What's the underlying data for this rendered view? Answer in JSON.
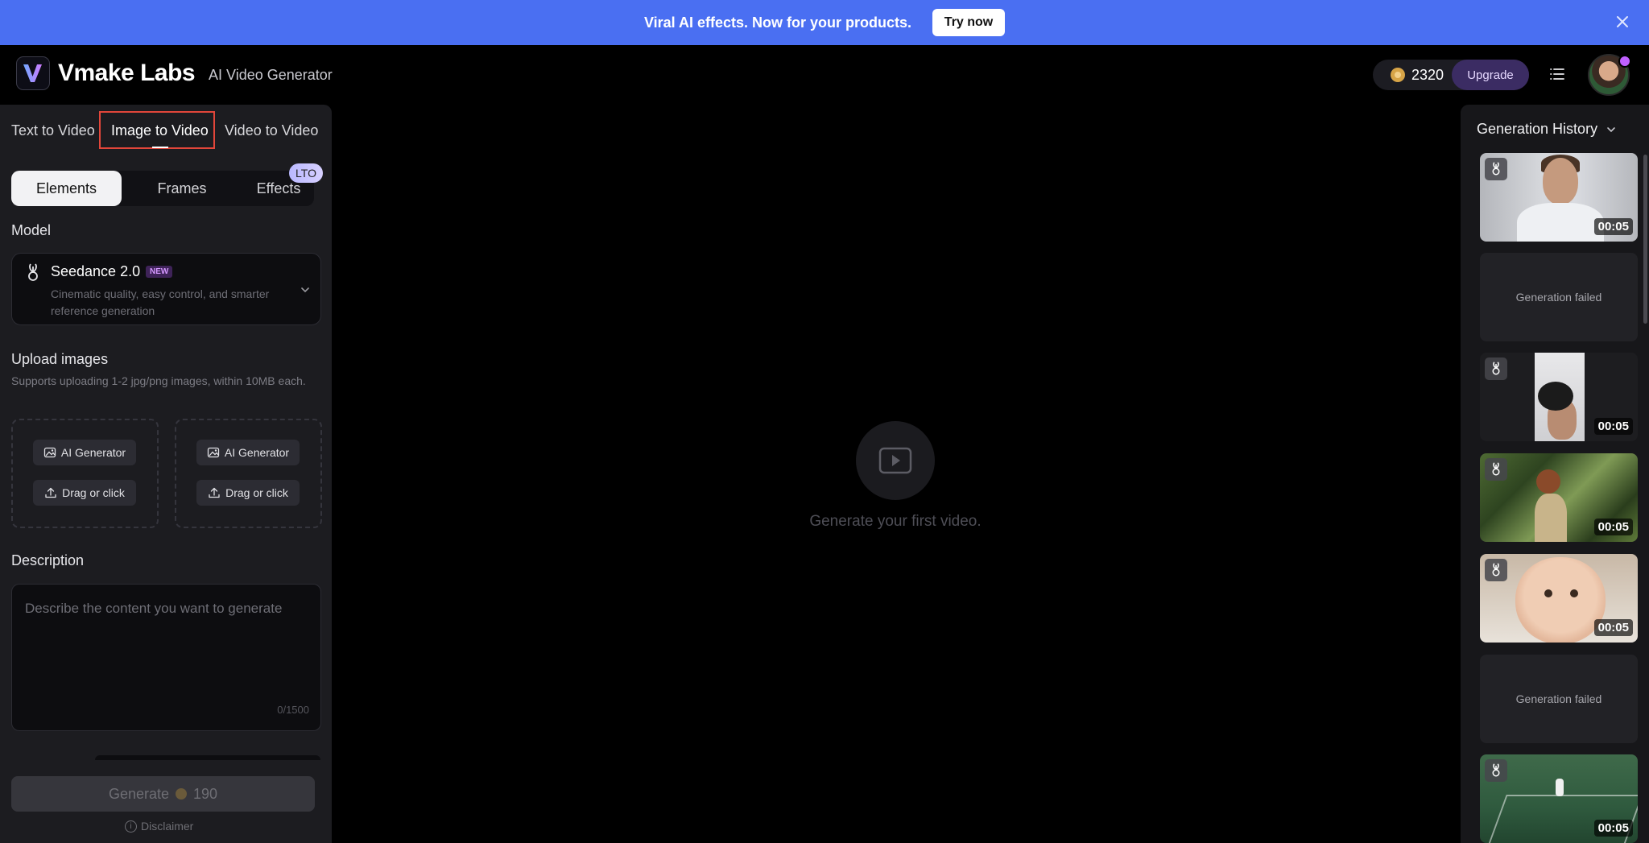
{
  "banner": {
    "text": "Viral AI effects. Now for your products.",
    "cta": "Try now"
  },
  "header": {
    "brand": "Vmake Labs",
    "subtitle": "AI Video Generator",
    "credits": "2320",
    "upgrade": "Upgrade"
  },
  "left": {
    "tabs": [
      "Text to Video",
      "Image to Video",
      "Video to Video"
    ],
    "active_tab": "Image to Video",
    "segments": [
      "Elements",
      "Frames",
      "Effects"
    ],
    "active_segment": "Elements",
    "lto_badge": "LTO",
    "model_label": "Model",
    "model": {
      "name": "Seedance 2.0",
      "badge": "NEW",
      "description": "Cinematic quality, easy control, and smarter reference generation"
    },
    "upload": {
      "label": "Upload images",
      "note": "Supports uploading 1-2 jpg/png images, within 10MB each.",
      "ai_generator": "AI Generator",
      "drag": "Drag or click"
    },
    "description": {
      "label": "Description",
      "placeholder": "Describe the content you want to generate",
      "count": "0/1500"
    },
    "generate": {
      "label": "Generate",
      "cost": "190"
    },
    "disclaimer": "Disclaimer"
  },
  "center": {
    "empty_text": "Generate your first video."
  },
  "history": {
    "title": "Generation History",
    "items": [
      {
        "status": "done",
        "duration": "00:05"
      },
      {
        "status": "failed",
        "text": "Generation failed"
      },
      {
        "status": "done",
        "duration": "00:05"
      },
      {
        "status": "done",
        "duration": "00:05"
      },
      {
        "status": "done",
        "duration": "00:05"
      },
      {
        "status": "failed",
        "text": "Generation failed"
      },
      {
        "status": "done",
        "duration": "00:05"
      }
    ]
  },
  "colors": {
    "banner": "#4a6ff2",
    "upgrade_bg": "#3b2c63",
    "highlight": "#e2463a"
  }
}
